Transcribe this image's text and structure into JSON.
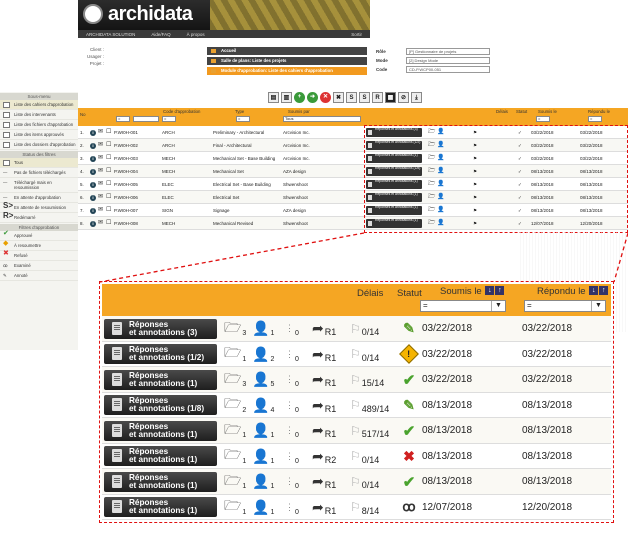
{
  "header": {
    "logo": "archidata",
    "nav": [
      "ARCHIDATA SOLUTION",
      "Aide/FAQ",
      "À propos",
      "Sortir"
    ]
  },
  "client_labels": [
    "Client :",
    "Usager :",
    "Projet :"
  ],
  "crumbs": [
    "Accueil",
    "Salle de plans: Liste des projets",
    "Module d'approbation: Liste des cahiers d'approbation"
  ],
  "role": {
    "items": [
      {
        "label": "Rôle",
        "value": "[P] Gestionnaire de projets"
      },
      {
        "label": "Mode",
        "value": "[2] Design Mode"
      },
      {
        "label": "Code",
        "value": "CD-P.WCP00-051"
      }
    ]
  },
  "sidebar": {
    "submenu_title": "Sous-menu",
    "submenu": [
      "Liste des cahiers d'approbation",
      "Liste des intervenants",
      "Liste des fichiers d'approbation",
      "Liste des items approuvés",
      "Liste des dossiers d'approbation"
    ],
    "status_title": "Status des filtres",
    "status": [
      "Tous",
      "Pas de fichiers téléchargés",
      "Téléchargé mais en resoumission",
      "En attente d'approbation",
      "En attente de resoumission",
      "Redémarré"
    ],
    "approval_title": "Filtres d'approbation",
    "approval": [
      "Approuvé",
      "À resoumettre",
      "Refusé",
      "Examiné",
      "Annoté"
    ]
  },
  "grid": {
    "headers": [
      "No",
      "Code d'approbation",
      "Type",
      "Soumis par",
      "Délais",
      "Statut",
      "Soumis le",
      "Répondu le"
    ],
    "filter_all": "Tous",
    "rows": [
      {
        "no": "1.",
        "code": "P.WI0H-001",
        "type": "ARCH",
        "title": "Preliminary - Architectural",
        "by": "Arcvision Inc.",
        "rep": "Réponses et annotations (3)",
        "soumis": "03/22/2018",
        "repondu": "03/22/2018"
      },
      {
        "no": "2.",
        "code": "P.WI0H-002",
        "type": "ARCH",
        "title": "Final - Architectural",
        "by": "Arcvision Inc.",
        "rep": "Réponses et annotations (1/2)",
        "soumis": "03/22/2018",
        "repondu": "03/22/2018"
      },
      {
        "no": "3.",
        "code": "P.WI0H-003",
        "type": "MECH",
        "title": "Mechanical Set - Base Building",
        "by": "Arcvision Inc.",
        "rep": "Réponses et annotations (1)",
        "soumis": "03/22/2018",
        "repondu": "03/22/2018"
      },
      {
        "no": "4.",
        "code": "P.WI0H-004",
        "type": "MECH",
        "title": "Mechanical Set",
        "by": "AZA design",
        "rep": "Réponses et annotations (1/8)",
        "soumis": "08/13/2018",
        "repondu": "08/13/2018"
      },
      {
        "no": "5.",
        "code": "P.WI0H-005",
        "type": "ELEC",
        "title": "Electrical Set - Base Building",
        "by": "Shwenshoot",
        "rep": "Réponses et annotations (1)",
        "soumis": "08/13/2018",
        "repondu": "08/13/2018"
      },
      {
        "no": "6.",
        "code": "P.WI0H-006",
        "type": "ELEC",
        "title": "Electrical Set",
        "by": "Shwenshoot",
        "rep": "Réponses et annotations (1)",
        "soumis": "08/13/2018",
        "repondu": "08/13/2018"
      },
      {
        "no": "7.",
        "code": "P.WI0H-007",
        "type": "SIGN",
        "title": "Signage",
        "by": "AZA design",
        "rep": "Réponses et annotations (1)",
        "soumis": "08/13/2018",
        "repondu": "08/13/2018"
      },
      {
        "no": "8.",
        "code": "P.WI0H-008",
        "type": "MECH",
        "title": "Mechanical Revised",
        "by": "Shwenshoot",
        "rep": "Réponses et annotations (1)",
        "soumis": "12/07/2018",
        "repondu": "12/20/2018"
      }
    ]
  },
  "zoom": {
    "headers": {
      "delais": "Délais",
      "statut": "Statut",
      "soumis": "Soumis le",
      "repondu": "Répondu le"
    },
    "filter_eq": "=",
    "rows": [
      {
        "rep1": "Réponses",
        "rep2": "et annotations (3)",
        "files": "3",
        "users": "1",
        "zero": "0",
        "rev": "R1",
        "delais": "0/14",
        "status": "pen",
        "soumis": "03/22/2018",
        "repondu": "03/22/2018"
      },
      {
        "rep1": "Réponses",
        "rep2": "et annotations (1/2)",
        "files": "1",
        "users": "2",
        "zero": "0",
        "rev": "R1",
        "delais": "0/14",
        "status": "warn",
        "soumis": "03/22/2018",
        "repondu": "03/22/2018"
      },
      {
        "rep1": "Réponses",
        "rep2": "et annotations (1)",
        "files": "3",
        "users": "5",
        "zero": "0",
        "rev": "R1",
        "delais": "15/14",
        "status": "check",
        "soumis": "03/22/2018",
        "repondu": "03/22/2018"
      },
      {
        "rep1": "Réponses",
        "rep2": "et annotations (1/8)",
        "files": "2",
        "users": "4",
        "zero": "0",
        "rev": "R1",
        "delais": "489/14",
        "status": "pen",
        "soumis": "08/13/2018",
        "repondu": "08/13/2018"
      },
      {
        "rep1": "Réponses",
        "rep2": "et annotations (1)",
        "files": "1",
        "users": "1",
        "zero": "0",
        "rev": "R1",
        "delais": "517/14",
        "status": "check",
        "soumis": "08/13/2018",
        "repondu": "08/13/2018"
      },
      {
        "rep1": "Réponses",
        "rep2": "et annotations (1)",
        "files": "1",
        "users": "1",
        "zero": "0",
        "rev": "R2",
        "delais": "0/14",
        "status": "x",
        "soumis": "08/13/2018",
        "repondu": "08/13/2018"
      },
      {
        "rep1": "Réponses",
        "rep2": "et annotations (1)",
        "files": "1",
        "users": "1",
        "zero": "0",
        "rev": "R1",
        "delais": "0/14",
        "status": "check",
        "soumis": "08/13/2018",
        "repondu": "08/13/2018"
      },
      {
        "rep1": "Réponses",
        "rep2": "et annotations (1)",
        "files": "1",
        "users": "1",
        "zero": "0",
        "rev": "R1",
        "delais": "8/14",
        "status": "glasses",
        "soumis": "12/07/2018",
        "repondu": "12/20/2018"
      }
    ]
  }
}
